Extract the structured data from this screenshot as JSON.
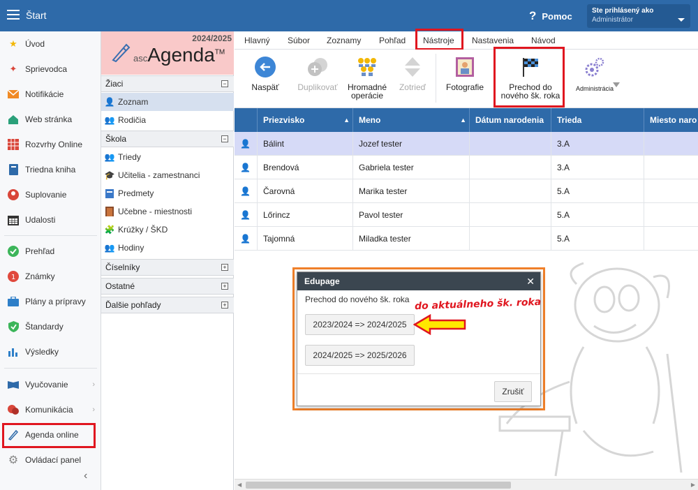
{
  "topbar": {
    "title": "Štart",
    "help_label": "Pomoc",
    "user_line1": "Ste prihlásený ako",
    "user_line2": "Administrátor"
  },
  "sidebar": {
    "items": [
      {
        "label": "Úvod",
        "icon": "star-icon"
      },
      {
        "label": "Sprievodca",
        "icon": "wand-icon"
      },
      {
        "label": "Notifikácie",
        "icon": "envelope-icon"
      },
      {
        "label": "Web stránka",
        "icon": "house-icon"
      },
      {
        "label": "Rozvrhy Online",
        "icon": "calendar-grid-icon"
      },
      {
        "label": "Triedna kniha",
        "icon": "book-icon"
      },
      {
        "label": "Suplovanie",
        "icon": "person-swap-icon"
      },
      {
        "label": "Udalosti",
        "icon": "calendar-icon"
      },
      {
        "label": "Prehľad",
        "icon": "check-circle-icon"
      },
      {
        "label": "Známky",
        "icon": "grade-icon"
      },
      {
        "label": "Plány a prípravy",
        "icon": "briefcase-icon"
      },
      {
        "label": "Štandardy",
        "icon": "shield-check-icon"
      },
      {
        "label": "Výsledky",
        "icon": "bar-chart-icon"
      },
      {
        "label": "Vyučovanie",
        "icon": "open-book-icon"
      },
      {
        "label": "Komunikácia",
        "icon": "chat-icon"
      },
      {
        "label": "Agenda online",
        "icon": "pen-icon"
      },
      {
        "label": "Ovládací panel",
        "icon": "gear-icon"
      }
    ]
  },
  "agenda": {
    "year": "2024/2025",
    "brand_prefix": "asc",
    "brand": "Agenda",
    "brand_tm": "TM",
    "sections": {
      "ziaci": "Žiaci",
      "skola": "Škola",
      "ciselniky": "Číselníky",
      "ostatne": "Ostatné",
      "dalsie": "Ďalšie pohľady"
    },
    "items": {
      "zoznam": "Zoznam",
      "rodicia": "Rodičia",
      "triedy": "Triedy",
      "ucitelia": "Učitelia - zamestnanci",
      "predmety": "Predmety",
      "ucebne": "Učebne - miestnosti",
      "kruzky": "Krúžky / ŠKD",
      "hodiny": "Hodiny"
    }
  },
  "menubar": [
    "Hlavný",
    "Súbor",
    "Zoznamy",
    "Pohľad",
    "Nástroje",
    "Nastavenia",
    "Návod"
  ],
  "toolbar": {
    "back": "Naspäť",
    "duplicate": "Duplikovať",
    "bulk_line1": "Hromadné",
    "bulk_line2": "operácie",
    "sort": "Zotrieď",
    "photos": "Fotografie",
    "transition_line1": "Prechod do",
    "transition_line2": "nového šk. roka",
    "admin": "Administrácia"
  },
  "grid": {
    "headers": [
      "Priezvisko",
      "Meno",
      "Dátum narodenia",
      "Trieda",
      "Miesto naro"
    ],
    "rows": [
      [
        "Bálint",
        "Jozef tester",
        "",
        "3.A"
      ],
      [
        "Brendová",
        "Gabriela tester",
        "",
        "3.A"
      ],
      [
        "Čarovná",
        "Marika tester",
        "",
        "5.A"
      ],
      [
        "Lőrincz",
        "Pavol tester",
        "",
        "5.A"
      ],
      [
        "Tajomná",
        "Miladka tester",
        "",
        "5.A"
      ]
    ]
  },
  "dialog": {
    "title": "Edupage",
    "prompt": "Prechod do nového šk. roka",
    "option1": "2023/2024 => 2024/2025",
    "option2": "2024/2025 => 2025/2026",
    "cancel": "Zrušiť"
  },
  "annotation": "do aktuálneho šk. roka",
  "colors": {
    "primary": "#2e6aa9",
    "highlight_red": "#e0161f",
    "highlight_orange": "#f0802a",
    "selected_row": "#d6daf7"
  }
}
